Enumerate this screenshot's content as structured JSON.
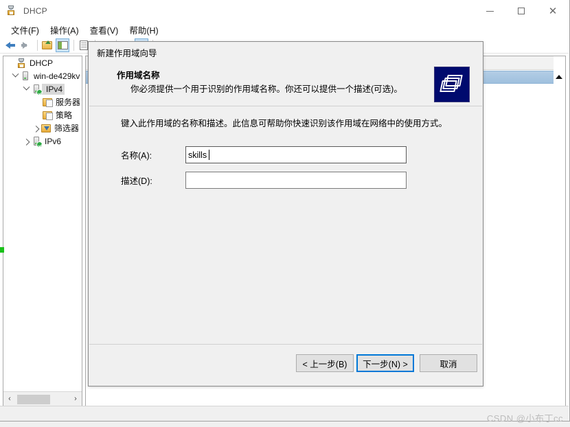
{
  "window": {
    "title": "DHCP",
    "icon": "dhcp-icon",
    "controls": {
      "minimize": "—",
      "maximize": "☐",
      "close": "✕"
    }
  },
  "menubar": {
    "items": [
      {
        "label": "文件(F)",
        "name": "menu-file"
      },
      {
        "label": "操作(A)",
        "name": "menu-action"
      },
      {
        "label": "查看(V)",
        "name": "menu-view"
      },
      {
        "label": "帮助(H)",
        "name": "menu-help"
      }
    ]
  },
  "toolbar": {
    "icons": [
      "back-arrow-icon",
      "forward-arrow-icon",
      "up-folder-icon",
      "show-tree-icon",
      "properties-icon",
      "new-window-icon",
      "refresh-icon",
      "export-list-icon",
      "help-icon"
    ]
  },
  "tree": {
    "items": [
      {
        "label": "DHCP",
        "icon": "dhcp-root-icon",
        "indent": 0,
        "twisty": "none",
        "selected": false
      },
      {
        "label": "win-de429kv",
        "icon": "server-icon",
        "indent": 1,
        "twisty": "down",
        "selected": false
      },
      {
        "label": "IPv4",
        "icon": "ipv4-icon",
        "indent": 2,
        "twisty": "down",
        "selected": true
      },
      {
        "label": "服务器",
        "icon": "server-options-icon",
        "indent": 3,
        "twisty": "none",
        "selected": false
      },
      {
        "label": "策略",
        "icon": "policies-icon",
        "indent": 3,
        "twisty": "none",
        "selected": false
      },
      {
        "label": "筛选器",
        "icon": "filters-icon",
        "indent": 3,
        "twisty": "right",
        "selected": false
      },
      {
        "label": "IPv6",
        "icon": "ipv6-icon",
        "indent": 2,
        "twisty": "right",
        "selected": false
      }
    ],
    "hscroll": {
      "left_arrow": "‹",
      "right_arrow": "›"
    }
  },
  "dialog": {
    "title": "新建作用域向导",
    "heading": "作用域名称",
    "subheading": "你必须提供一个用于识别的作用域名称。你还可以提供一个描述(可选)。",
    "header_icon": "folder-stack-icon",
    "body_text": "键入此作用域的名称和描述。此信息可帮助你快速识别该作用域在网络中的使用方式。",
    "fields": [
      {
        "label": "名称(A):",
        "value": "skills",
        "placeholder": "",
        "focused": true
      },
      {
        "label": "描述(D):",
        "value": "",
        "placeholder": "",
        "focused": false
      }
    ],
    "buttons": [
      {
        "label": "< 上一步(B)",
        "name": "back-button",
        "default": false
      },
      {
        "label": "下一步(N) >",
        "name": "next-button",
        "default": true
      },
      {
        "label": "取消",
        "name": "cancel-button",
        "default": false
      }
    ]
  },
  "watermark": {
    "text": "CSDN @小布丁cc"
  },
  "colors": {
    "accent_focus": "#0078d7",
    "selection_blue": "#9fc0de",
    "tree_selection": "#d8d8d8",
    "dialog_bg": "#f0f0f0",
    "header_icon_bg": "#000a6e",
    "status_green": "#2faa46",
    "marker_green": "#19c119"
  }
}
